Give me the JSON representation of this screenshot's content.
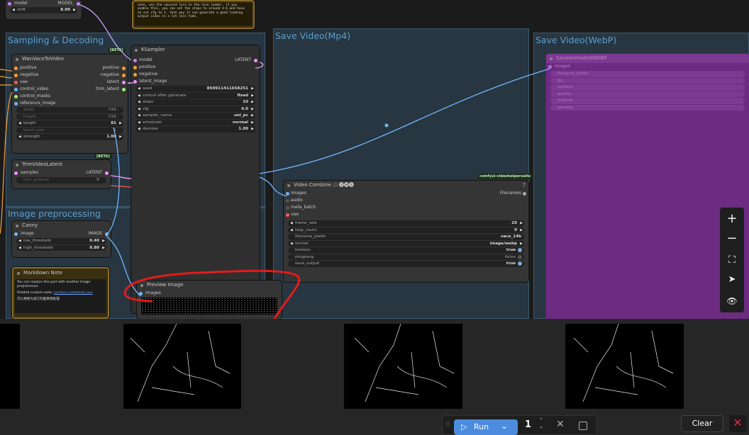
{
  "groups": {
    "sampling": "Sampling & Decoding",
    "mp4": "Save Video(Mp4)",
    "webp": "Save Video(WebP)",
    "preproc": "Image preprocessing"
  },
  "top_node": {
    "row1_left": "model",
    "row1_right": "MODEL",
    "shift_label": "shift",
    "shift_value": "8.00"
  },
  "note_top": "note, use the causvid lora in the lora loader. if you enable this, you can set the steps to around 4-6 and have to set cfg to 1. that way it can generate a good looking output video in a lot less time.",
  "wanvace": {
    "title": "WanVaceToVideo",
    "beta": "[BETA]",
    "inputs": [
      "positive",
      "negative",
      "vae",
      "control_video",
      "control_masks",
      "reference_image"
    ],
    "outputs": [
      "positive",
      "negative",
      "latent",
      "trim_latent"
    ],
    "widgets": [
      {
        "label": "width",
        "value": "720"
      },
      {
        "label": "height",
        "value": "720"
      },
      {
        "label": "length",
        "value": "81"
      },
      {
        "label": "batch_size",
        "value": "1"
      },
      {
        "label": "strength",
        "value": "1.00"
      }
    ],
    "footer_badge": "[BETA]"
  },
  "ksampler": {
    "title": "KSampler",
    "inputs": [
      "model",
      "positive",
      "negative",
      "latent_image"
    ],
    "output": "LATENT",
    "widgets": [
      {
        "label": "seed",
        "value": "859911411658251"
      },
      {
        "label": "control after generate",
        "value": "fixed"
      },
      {
        "label": "steps",
        "value": "10"
      },
      {
        "label": "cfg",
        "value": "4.0"
      },
      {
        "label": "sampler_name",
        "value": "uni_pc"
      },
      {
        "label": "scheduler",
        "value": "normal"
      },
      {
        "label": "denoise",
        "value": "1.00"
      }
    ]
  },
  "trim": {
    "title": "TrimVideoLatent",
    "input": "samples",
    "output": "LATENT",
    "widget_label": "trim_amount",
    "widget_value": "0"
  },
  "canny": {
    "title": "Canny",
    "input": "image",
    "output": "IMAGE",
    "w1_label": "low_threshold",
    "w1_value": "0.40",
    "w2_label": "high_threshold",
    "w2_value": "0.80"
  },
  "md_note": {
    "title": "Markdown Note",
    "line1": "You can replace this part with another image preprocessor.",
    "line2_prefix": "Related custom node: ",
    "line2_link": "comfyui_controlnet_aux",
    "line3": "可以更换为其它的图像预处理"
  },
  "preview": {
    "title": "Preview Image",
    "input": "images"
  },
  "videocombine": {
    "badge": "comfyui-videohelpersuite",
    "title": "Video Combine 🎥🅥🅗🅢",
    "help": "?",
    "inputs": [
      "images",
      "audio",
      "meta_batch",
      "vae"
    ],
    "output": "Filenames",
    "widgets": [
      {
        "label": "frame_rate",
        "value": "20"
      },
      {
        "label": "loop_count",
        "value": "0"
      },
      {
        "label": "filename_prefix",
        "value": "vace_14b"
      },
      {
        "label": "format",
        "value": "image/webp"
      },
      {
        "label": "lossless",
        "value": "true"
      },
      {
        "label": "pingpong",
        "value": "false"
      },
      {
        "label": "save_output",
        "value": "true"
      }
    ]
  },
  "saveanim": {
    "title": "SaveAnimatedWEBP",
    "input": "images",
    "widgets": [
      "filename_prefix",
      "fps",
      "lossless",
      "quality",
      "method",
      "preview"
    ]
  },
  "zoom": {
    "plus": "+",
    "minus": "−",
    "fit": "⛶",
    "nav": "➤",
    "eye": "👁"
  },
  "run": {
    "label": "Run",
    "count": "1"
  },
  "clear": "Clear",
  "close": "✕"
}
